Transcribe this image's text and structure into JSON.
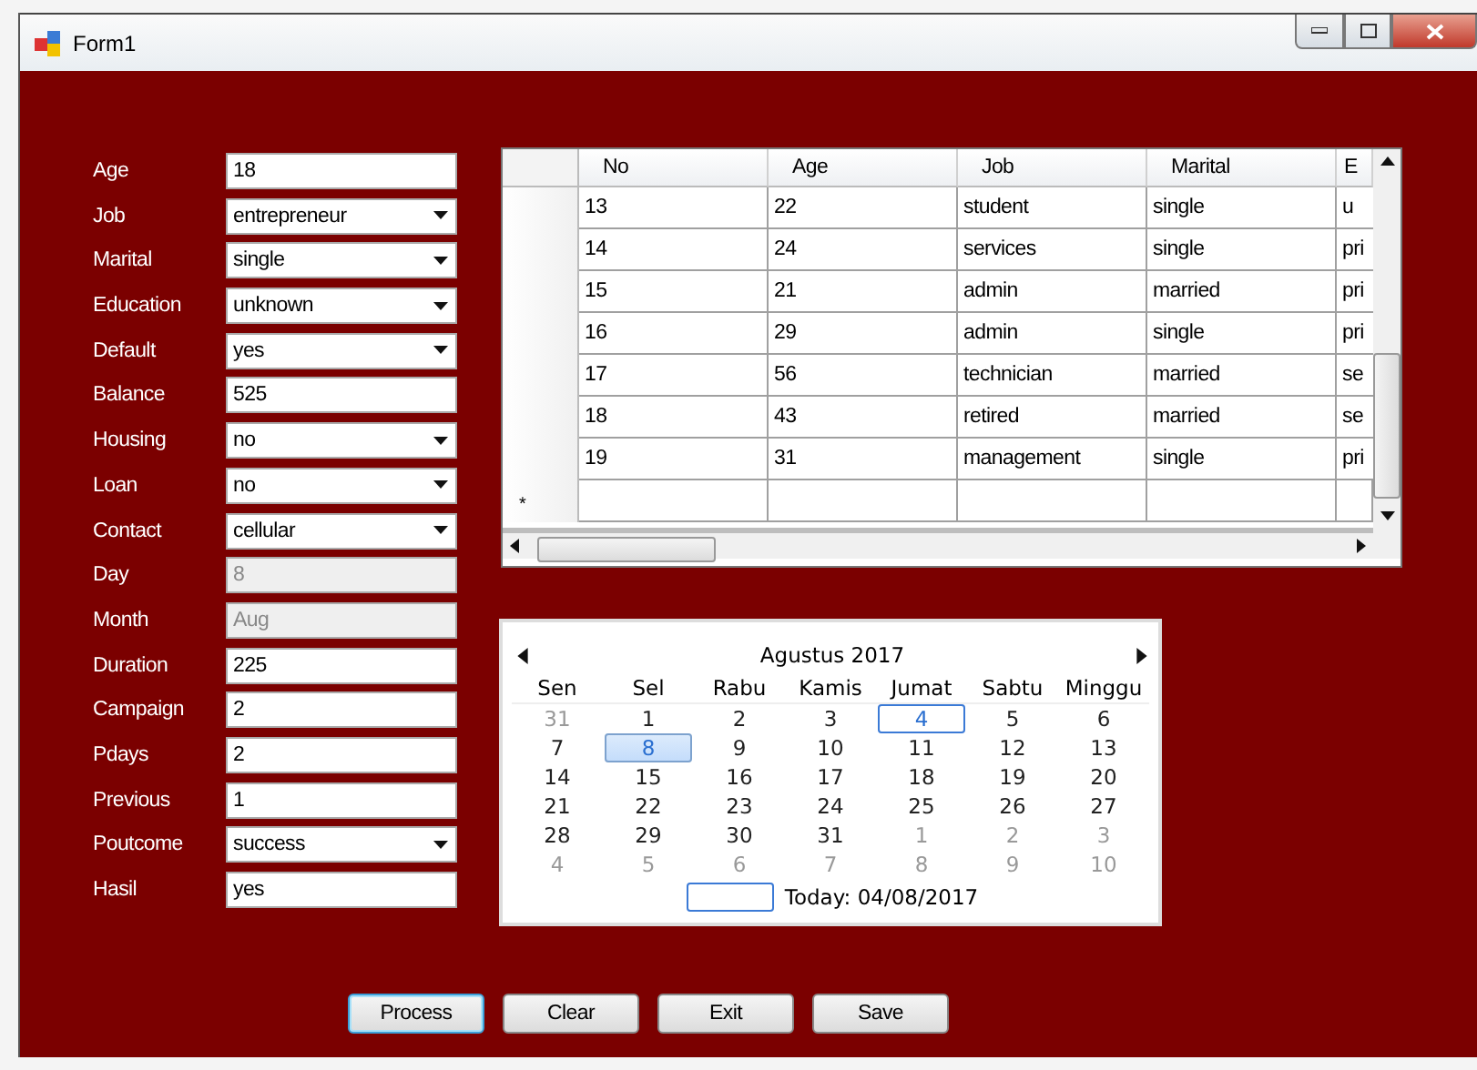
{
  "window": {
    "title": "Form1"
  },
  "fields": [
    {
      "label": "Age",
      "value": "18",
      "kind": "text",
      "disabled": false
    },
    {
      "label": "Job",
      "value": "entrepreneur",
      "kind": "combo",
      "disabled": false
    },
    {
      "label": "Marital",
      "value": "single",
      "kind": "combo",
      "disabled": false
    },
    {
      "label": "Education",
      "value": "unknown",
      "kind": "combo",
      "disabled": false
    },
    {
      "label": "Default",
      "value": "yes",
      "kind": "combo",
      "disabled": false
    },
    {
      "label": "Balance",
      "value": "525",
      "kind": "text",
      "disabled": false
    },
    {
      "label": "Housing",
      "value": "no",
      "kind": "combo",
      "disabled": false
    },
    {
      "label": "Loan",
      "value": "no",
      "kind": "combo",
      "disabled": false
    },
    {
      "label": "Contact",
      "value": "cellular",
      "kind": "combo",
      "disabled": false
    },
    {
      "label": "Day",
      "value": "8",
      "kind": "text",
      "disabled": true
    },
    {
      "label": "Month",
      "value": "Aug",
      "kind": "text",
      "disabled": true
    },
    {
      "label": "Duration",
      "value": "225",
      "kind": "text",
      "disabled": false
    },
    {
      "label": "Campaign",
      "value": "2",
      "kind": "text",
      "disabled": false
    },
    {
      "label": "Pdays",
      "value": "2",
      "kind": "text",
      "disabled": false
    },
    {
      "label": "Previous",
      "value": "1",
      "kind": "text",
      "disabled": false
    },
    {
      "label": "Poutcome",
      "value": "success",
      "kind": "combo",
      "disabled": false
    },
    {
      "label": "Hasil",
      "value": "yes",
      "kind": "text",
      "disabled": false
    }
  ],
  "table": {
    "columns": [
      "No",
      "Age",
      "Job",
      "Marital",
      "E"
    ],
    "rows": [
      [
        "13",
        "22",
        "student",
        "single",
        "u"
      ],
      [
        "14",
        "24",
        "services",
        "single",
        "pri"
      ],
      [
        "15",
        "21",
        "admin",
        "married",
        "pri"
      ],
      [
        "16",
        "29",
        "admin",
        "single",
        "pri"
      ],
      [
        "17",
        "56",
        "technician",
        "married",
        "se"
      ],
      [
        "18",
        "43",
        "retired",
        "married",
        "se"
      ],
      [
        "19",
        "31",
        "management",
        "single",
        "pri"
      ]
    ],
    "new_row_marker": "*"
  },
  "calendar": {
    "month": "Agustus 2017",
    "weekdays": [
      "Sen",
      "Sel",
      "Rabu",
      "Kamis",
      "Jumat",
      "Sabtu",
      "Minggu"
    ],
    "weeks": [
      [
        {
          "text": "31",
          "other_month": true,
          "selected": false,
          "today": false
        },
        {
          "text": "1",
          "other_month": false,
          "selected": false,
          "today": false
        },
        {
          "text": "2",
          "other_month": false,
          "selected": false,
          "today": false
        },
        {
          "text": "3",
          "other_month": false,
          "selected": false,
          "today": false
        },
        {
          "text": "4",
          "other_month": false,
          "selected": false,
          "today": true
        },
        {
          "text": "5",
          "other_month": false,
          "selected": false,
          "today": false
        },
        {
          "text": "6",
          "other_month": false,
          "selected": false,
          "today": false
        }
      ],
      [
        {
          "text": "7",
          "other_month": false,
          "selected": false,
          "today": false
        },
        {
          "text": "8",
          "other_month": false,
          "selected": true,
          "today": false
        },
        {
          "text": "9",
          "other_month": false,
          "selected": false,
          "today": false
        },
        {
          "text": "10",
          "other_month": false,
          "selected": false,
          "today": false
        },
        {
          "text": "11",
          "other_month": false,
          "selected": false,
          "today": false
        },
        {
          "text": "12",
          "other_month": false,
          "selected": false,
          "today": false
        },
        {
          "text": "13",
          "other_month": false,
          "selected": false,
          "today": false
        }
      ],
      [
        {
          "text": "14",
          "other_month": false,
          "selected": false,
          "today": false
        },
        {
          "text": "15",
          "other_month": false,
          "selected": false,
          "today": false
        },
        {
          "text": "16",
          "other_month": false,
          "selected": false,
          "today": false
        },
        {
          "text": "17",
          "other_month": false,
          "selected": false,
          "today": false
        },
        {
          "text": "18",
          "other_month": false,
          "selected": false,
          "today": false
        },
        {
          "text": "19",
          "other_month": false,
          "selected": false,
          "today": false
        },
        {
          "text": "20",
          "other_month": false,
          "selected": false,
          "today": false
        }
      ],
      [
        {
          "text": "21",
          "other_month": false,
          "selected": false,
          "today": false
        },
        {
          "text": "22",
          "other_month": false,
          "selected": false,
          "today": false
        },
        {
          "text": "23",
          "other_month": false,
          "selected": false,
          "today": false
        },
        {
          "text": "24",
          "other_month": false,
          "selected": false,
          "today": false
        },
        {
          "text": "25",
          "other_month": false,
          "selected": false,
          "today": false
        },
        {
          "text": "26",
          "other_month": false,
          "selected": false,
          "today": false
        },
        {
          "text": "27",
          "other_month": false,
          "selected": false,
          "today": false
        }
      ],
      [
        {
          "text": "28",
          "other_month": false,
          "selected": false,
          "today": false
        },
        {
          "text": "29",
          "other_month": false,
          "selected": false,
          "today": false
        },
        {
          "text": "30",
          "other_month": false,
          "selected": false,
          "today": false
        },
        {
          "text": "31",
          "other_month": false,
          "selected": false,
          "today": false
        },
        {
          "text": "1",
          "other_month": true,
          "selected": false,
          "today": false
        },
        {
          "text": "2",
          "other_month": true,
          "selected": false,
          "today": false
        },
        {
          "text": "3",
          "other_month": true,
          "selected": false,
          "today": false
        }
      ],
      [
        {
          "text": "4",
          "other_month": true,
          "selected": false,
          "today": false
        },
        {
          "text": "5",
          "other_month": true,
          "selected": false,
          "today": false
        },
        {
          "text": "6",
          "other_month": true,
          "selected": false,
          "today": false
        },
        {
          "text": "7",
          "other_month": true,
          "selected": false,
          "today": false
        },
        {
          "text": "8",
          "other_month": true,
          "selected": false,
          "today": false
        },
        {
          "text": "9",
          "other_month": true,
          "selected": false,
          "today": false
        },
        {
          "text": "10",
          "other_month": true,
          "selected": false,
          "today": false
        }
      ]
    ],
    "today_label": "Today: 04/08/2017"
  },
  "buttons": [
    {
      "label": "Process",
      "focused": true
    },
    {
      "label": "Clear",
      "focused": false
    },
    {
      "label": "Exit",
      "focused": false
    },
    {
      "label": "Save",
      "focused": false
    }
  ]
}
